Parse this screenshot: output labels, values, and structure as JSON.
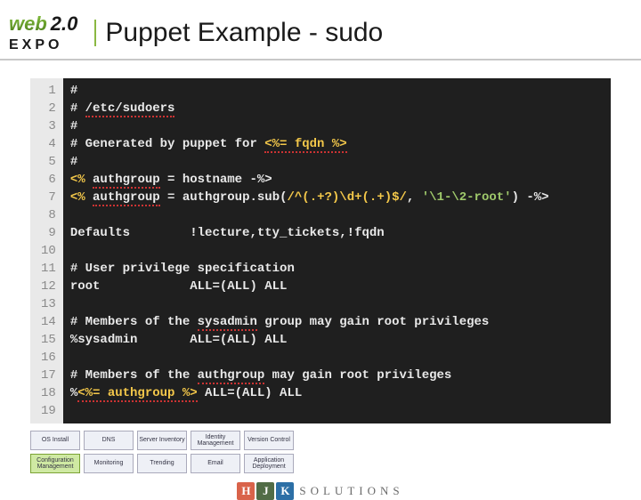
{
  "logo": {
    "word": "web",
    "ver": "2.0",
    "sub": "EXPO"
  },
  "title": "Puppet Example - sudo",
  "code": {
    "gutter": [
      "1",
      "2",
      "3",
      "4",
      "5",
      "6",
      "7",
      "8",
      "9",
      "10",
      "11",
      "12",
      "13",
      "14",
      "15",
      "16",
      "17",
      "18",
      "19"
    ],
    "l1": "#",
    "l2a": "# ",
    "l2b": "/etc/sudoers",
    "l3": "#",
    "l4a": "# Generated by puppet for ",
    "l4b": "<%= fqdn %>",
    "l5": "#",
    "l6a": "<% ",
    "l6b": "authgroup",
    "l6c": " = hostname -%>",
    "l7a": "<% ",
    "l7b": "authgroup",
    "l7c": " = ",
    "l7d": "authgroup.sub(",
    "l7e": "/^(.+?)\\d+(.+)$/",
    "l7f": ", ",
    "l7g": "'\\1-\\2-root'",
    "l7h": ") -%>",
    "l8": "",
    "l9": "Defaults        !lecture,tty_tickets,!fqdn",
    "l10": "",
    "l11": "# User privilege specification",
    "l12": "root            ALL=(ALL) ALL",
    "l13": "",
    "l14a": "# Members of the ",
    "l14b": "sysadmin",
    "l14c": " group may gain root privileges",
    "l15": "%sysadmin       ALL=(ALL) ALL",
    "l16": "",
    "l17a": "# Members of the ",
    "l17b": "authgroup",
    "l17c": " may gain root privileges",
    "l18a": "%",
    "l18b": "<%= authgroup %>",
    "l18c": " ALL=(ALL) ALL",
    "l19": ""
  },
  "boxes": {
    "row1": [
      "OS Install",
      "DNS",
      "Server Inventory",
      "Identity Management",
      "Version Control"
    ],
    "row2": [
      "Configuration Management",
      "Monitoring",
      "Trending",
      "Email",
      "Application Deployment"
    ]
  },
  "footer": {
    "h": "H",
    "j": "J",
    "k": "K",
    "text": "SOLUTIONS"
  }
}
